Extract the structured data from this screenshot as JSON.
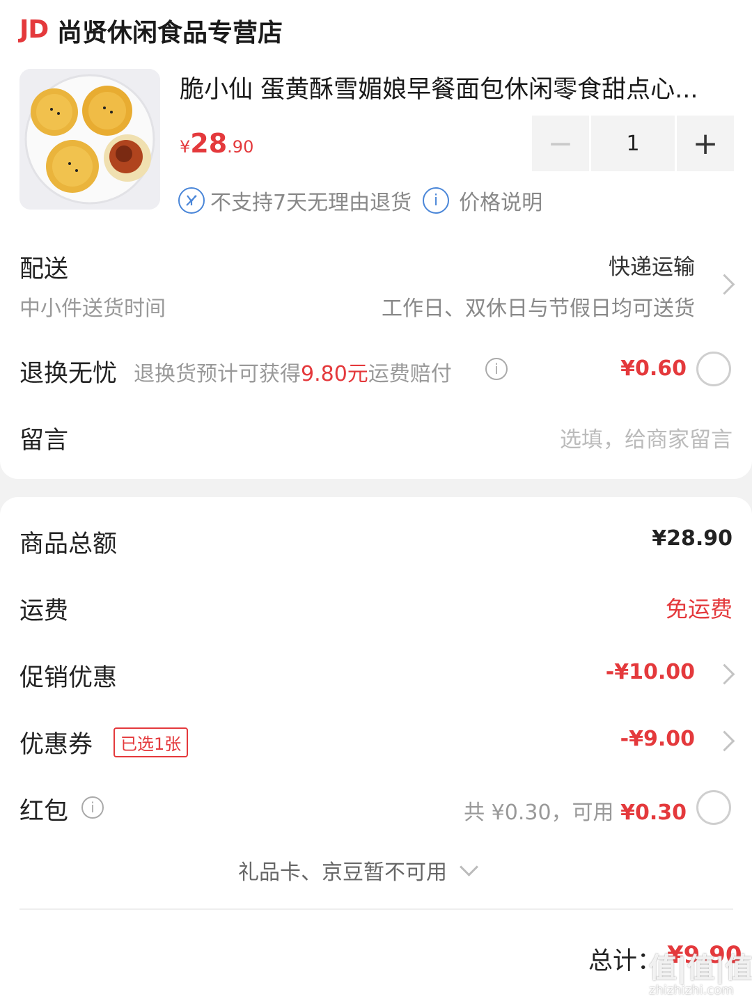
{
  "shop": {
    "logo": "JD",
    "name": "尚贤休闲食品专营店"
  },
  "product": {
    "title": "脆小仙 蛋黄酥雪媚娘早餐面包休闲零食甜点心...",
    "price_currency": "¥",
    "price_integer": "28",
    "price_decimal": ".90",
    "quantity": "1",
    "policy_return": "不支持7天无理由退货",
    "policy_price": "价格说明"
  },
  "delivery": {
    "label": "配送",
    "method": "快递运输",
    "time_label": "中小件送货时间",
    "time_value": "工作日、双休日与节假日均可送货"
  },
  "return_service": {
    "label": "退换无忧",
    "desc_prefix": "退换货预计可获得",
    "desc_amount": "9.80元",
    "desc_suffix": "运费赔付",
    "price": "¥0.60"
  },
  "message": {
    "label": "留言",
    "placeholder": "选填，给商家留言"
  },
  "summary": {
    "goods_total_label": "商品总额",
    "goods_total_value": "¥28.90",
    "shipping_label": "运费",
    "shipping_value": "免运费",
    "promo_label": "促销优惠",
    "promo_value": "-¥10.00",
    "coupon_label": "优惠券",
    "coupon_tag": "已选1张",
    "coupon_value": "-¥9.00",
    "redpacket_label": "红包",
    "redpacket_total": "共 ¥0.30，可用",
    "redpacket_available": "¥0.30",
    "giftcard_note": "礼品卡、京豆暂不可用",
    "total_label": "总计：",
    "total_value": "¥9.90"
  },
  "watermark": {
    "text_top": "值|值|值",
    "text_bottom": "zhizhizhi.com"
  },
  "colors": {
    "accent_red": "#e4393c",
    "info_blue": "#4a86d8"
  }
}
